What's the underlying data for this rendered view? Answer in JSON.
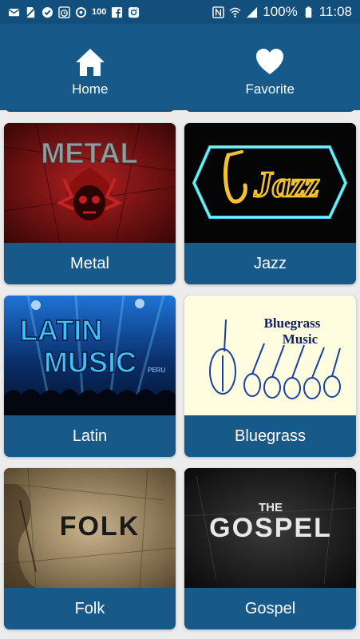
{
  "status_bar": {
    "left_icons": [
      "mail-icon",
      "no-sim-icon",
      "check-circle-icon",
      "clock-icon",
      "sync-icon",
      "fb-icon",
      "instagram-icon"
    ],
    "signal_text": "100",
    "battery": "100%",
    "time": "11:08"
  },
  "tabs": [
    {
      "label": "Home",
      "icon": "home-icon"
    },
    {
      "label": "Favorite",
      "icon": "heart-icon"
    }
  ],
  "genres": [
    {
      "label": "Metal",
      "art_text": "METAL",
      "colors": {
        "bg": "#5a0d0d",
        "accent": "#b21c1c",
        "text": "#9a9a9a"
      }
    },
    {
      "label": "Jazz",
      "art_text": "Jazz",
      "colors": {
        "bg": "#050505",
        "accent": "#3fd8e6",
        "text": "#f2c230"
      }
    },
    {
      "label": "Latin",
      "art_text": "LATIN MUSIC",
      "sub_text": "PERU",
      "colors": {
        "bg": "#0a2f6b",
        "accent": "#1f8bff",
        "text": "#3ec2ff"
      }
    },
    {
      "label": "Bluegrass",
      "art_text": "Bluegrass Music",
      "colors": {
        "bg": "#fffde0",
        "accent": "#1a3fa3",
        "text": "#0f1f6b"
      }
    },
    {
      "label": "Folk",
      "art_text": "FOLK",
      "colors": {
        "bg": "#8c7a5a",
        "accent": "#3a2a18",
        "text": "#1a1a1a"
      }
    },
    {
      "label": "Gospel",
      "art_text": "GOSPEL",
      "pre_text": "THE",
      "colors": {
        "bg": "#141414",
        "accent": "#3a3a3a",
        "text": "#e8e8e8"
      }
    }
  ],
  "colors": {
    "header": "#175a8a",
    "status": "#124f7d",
    "label_bg": "#175a8a",
    "page_bg": "#ececec"
  }
}
